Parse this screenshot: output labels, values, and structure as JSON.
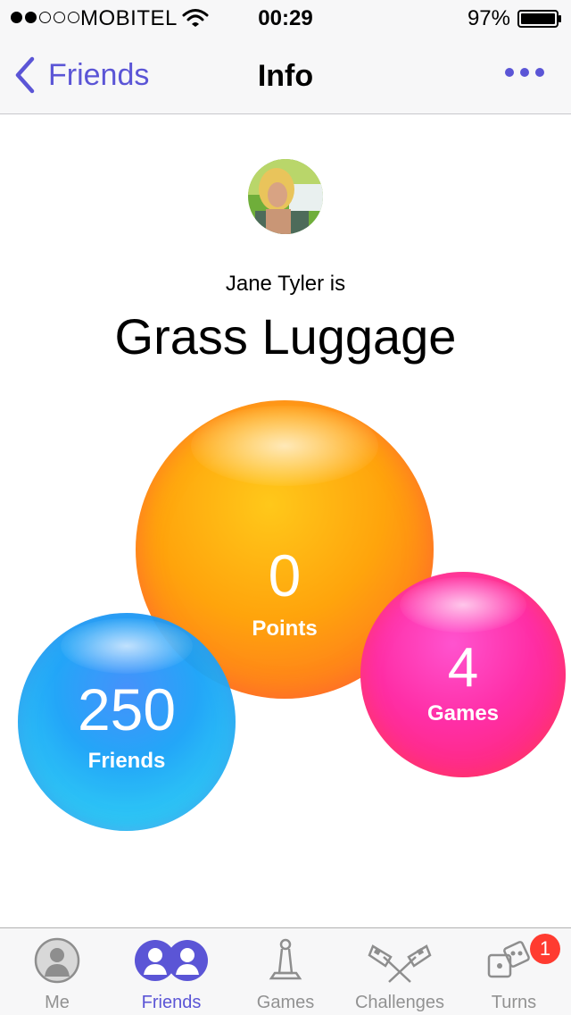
{
  "status_bar": {
    "carrier": "MOBITEL",
    "time": "00:29",
    "battery": "97%",
    "signal_bars_filled": 2,
    "signal_bars_total": 5
  },
  "nav": {
    "back_label": "Friends",
    "title": "Info",
    "more_icon": "ellipsis-icon"
  },
  "profile": {
    "subtitle": "Jane Tyler is",
    "nickname": "Grass Luggage"
  },
  "stats": {
    "points": {
      "value": "0",
      "label": "Points",
      "color": "#ffa40c"
    },
    "games": {
      "value": "4",
      "label": "Games",
      "color": "#ff2ea6"
    },
    "friends": {
      "value": "250",
      "label": "Friends",
      "color": "#1ba3f8"
    }
  },
  "tab_bar": {
    "active_color": "#5b55d6",
    "inactive_color": "#929292",
    "tabs": [
      {
        "label": "Me",
        "icon": "person-icon"
      },
      {
        "label": "Friends",
        "icon": "friends-icon"
      },
      {
        "label": "Games",
        "icon": "game-piece-icon"
      },
      {
        "label": "Challenges",
        "icon": "flags-icon"
      },
      {
        "label": "Turns",
        "icon": "dice-icon",
        "badge": "1"
      }
    ]
  }
}
